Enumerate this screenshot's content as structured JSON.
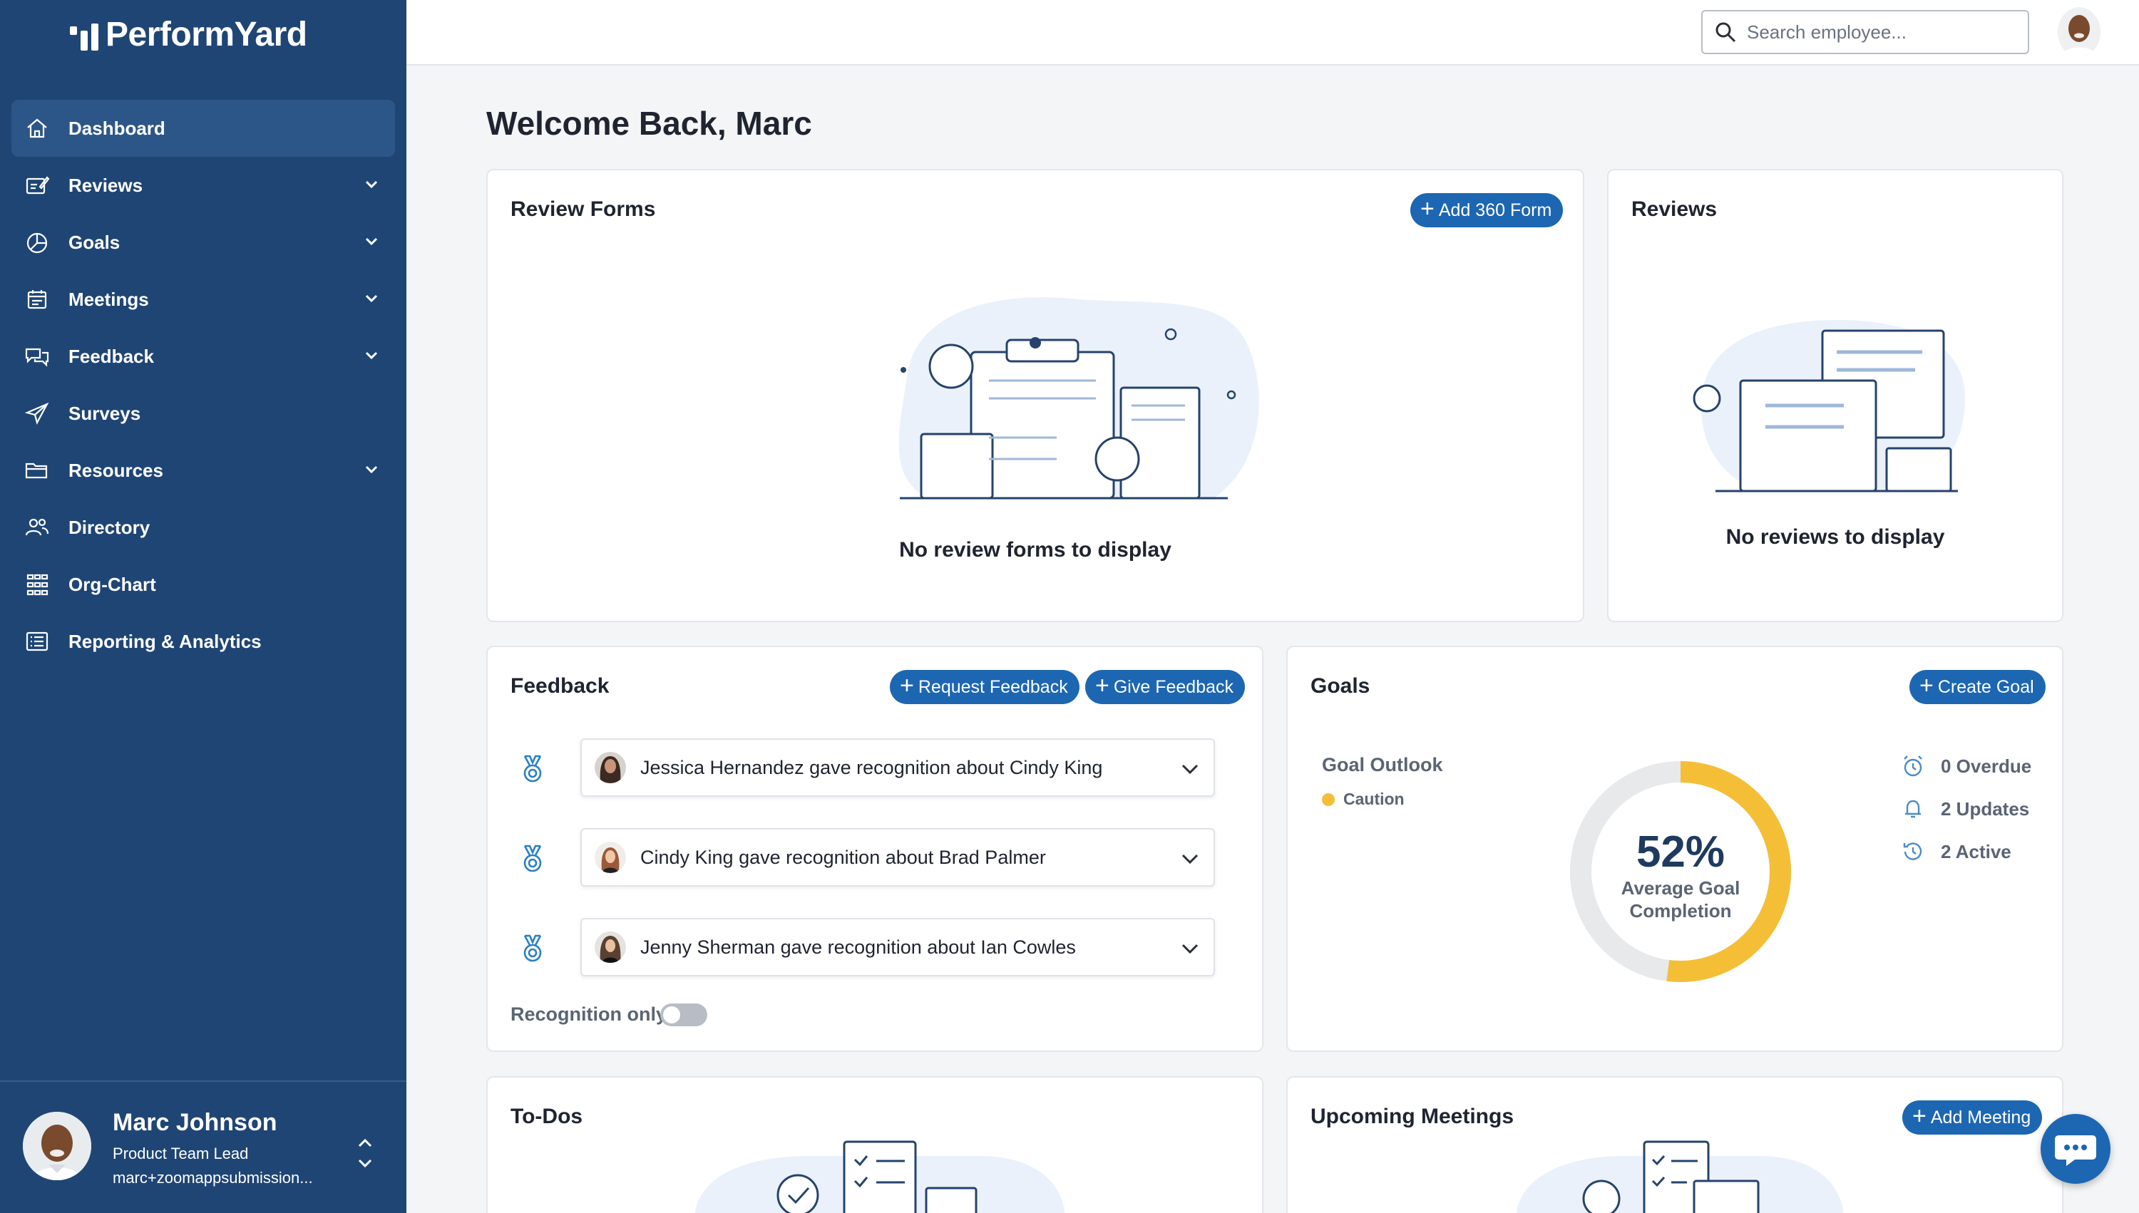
{
  "app": {
    "name": "PerformYard"
  },
  "sidebar": {
    "items": [
      {
        "label": "Dashboard",
        "icon": "home-icon",
        "active": true,
        "expandable": false
      },
      {
        "label": "Reviews",
        "icon": "review-icon",
        "active": false,
        "expandable": true
      },
      {
        "label": "Goals",
        "icon": "pie-chart-icon",
        "active": false,
        "expandable": true
      },
      {
        "label": "Meetings",
        "icon": "calendar-icon",
        "active": false,
        "expandable": true
      },
      {
        "label": "Feedback",
        "icon": "chat-bubbles-icon",
        "active": false,
        "expandable": true
      },
      {
        "label": "Surveys",
        "icon": "paper-plane-icon",
        "active": false,
        "expandable": false
      },
      {
        "label": "Resources",
        "icon": "folder-icon",
        "active": false,
        "expandable": true
      },
      {
        "label": "Directory",
        "icon": "people-icon",
        "active": false,
        "expandable": false
      },
      {
        "label": "Org-Chart",
        "icon": "org-chart-icon",
        "active": false,
        "expandable": false
      },
      {
        "label": "Reporting & Analytics",
        "icon": "report-icon",
        "active": false,
        "expandable": false
      }
    ],
    "user": {
      "name": "Marc Johnson",
      "title": "Product Team Lead",
      "email": "marc+zoomappsubmission..."
    }
  },
  "header": {
    "search_placeholder": "Search employee..."
  },
  "main": {
    "welcome": "Welcome Back, Marc",
    "review_forms": {
      "title": "Review Forms",
      "add_button": "Add 360 Form",
      "empty": "No review forms to display"
    },
    "reviews": {
      "title": "Reviews",
      "empty": "No reviews to display"
    },
    "feedback": {
      "title": "Feedback",
      "request_button": "Request Feedback",
      "give_button": "Give Feedback",
      "items": [
        {
          "text": "Jessica Hernandez gave recognition about Cindy King"
        },
        {
          "text": "Cindy King gave recognition about Brad Palmer"
        },
        {
          "text": "Jenny Sherman gave recognition about Ian Cowles"
        }
      ],
      "recognition_toggle_label": "Recognition only",
      "recognition_only": false
    },
    "goals": {
      "title": "Goals",
      "create_button": "Create Goal",
      "outlook_label": "Goal Outlook",
      "outlook_status": "Caution",
      "completion_percent": 52,
      "completion_text": "52%",
      "completion_label_1": "Average Goal",
      "completion_label_2": "Completion",
      "stats": [
        {
          "label": "0 Overdue",
          "icon": "alarm-clock-icon"
        },
        {
          "label": "2 Updates",
          "icon": "bell-icon"
        },
        {
          "label": "2 Active",
          "icon": "history-icon"
        }
      ]
    },
    "todos": {
      "title": "To-Dos"
    },
    "meetings": {
      "title": "Upcoming Meetings",
      "add_button": "Add Meeting"
    }
  },
  "colors": {
    "sidebar_bg": "#1f4575",
    "accent": "#1d66b2",
    "caution": "#f4be37",
    "donut_track": "#e8e9eb"
  }
}
